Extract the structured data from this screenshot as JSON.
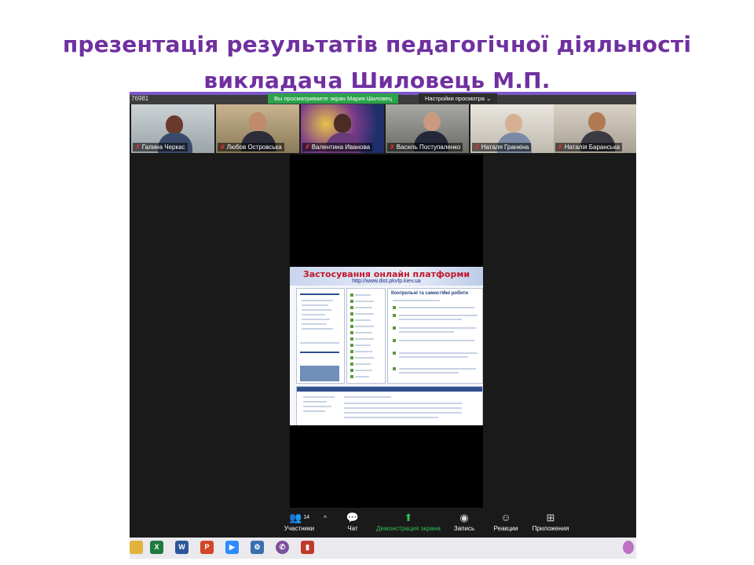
{
  "slide": {
    "title_line1": "презентація результатів педагогічної діяльності",
    "title_line2": "викладача Шиловець М.П."
  },
  "zoom": {
    "meeting_id_fragment": "76981",
    "share_label": "Вы просматриваете экран Мария Шиловец",
    "view_options": "Настройки просмотра ⌄",
    "participants": [
      {
        "name": "Галина Черкас"
      },
      {
        "name": "Любов  Островська"
      },
      {
        "name": "Валентина Иванова"
      },
      {
        "name": "Василь Поступаленко"
      },
      {
        "name": "Наталя Гранкіна"
      },
      {
        "name": "Наталія Баранська"
      }
    ],
    "shared_slide": {
      "title": "Застосування онлайн платформи",
      "url": "http://www.dist.pkvfp.kiev.ua",
      "panel_header": "Контрольні та самостійні роботи"
    },
    "controls": {
      "participants_label": "Участники",
      "participants_count": "14",
      "chat_label": "Чат",
      "share_label": "Демонстрация экрана",
      "record_label": "Запись",
      "reactions_label": "Реакции",
      "apps_label": "Приложения"
    }
  },
  "colors": {
    "title": "#7030a0",
    "zoom_green": "#2aa34a",
    "zoom_purple_strip": "#7a57c9"
  }
}
